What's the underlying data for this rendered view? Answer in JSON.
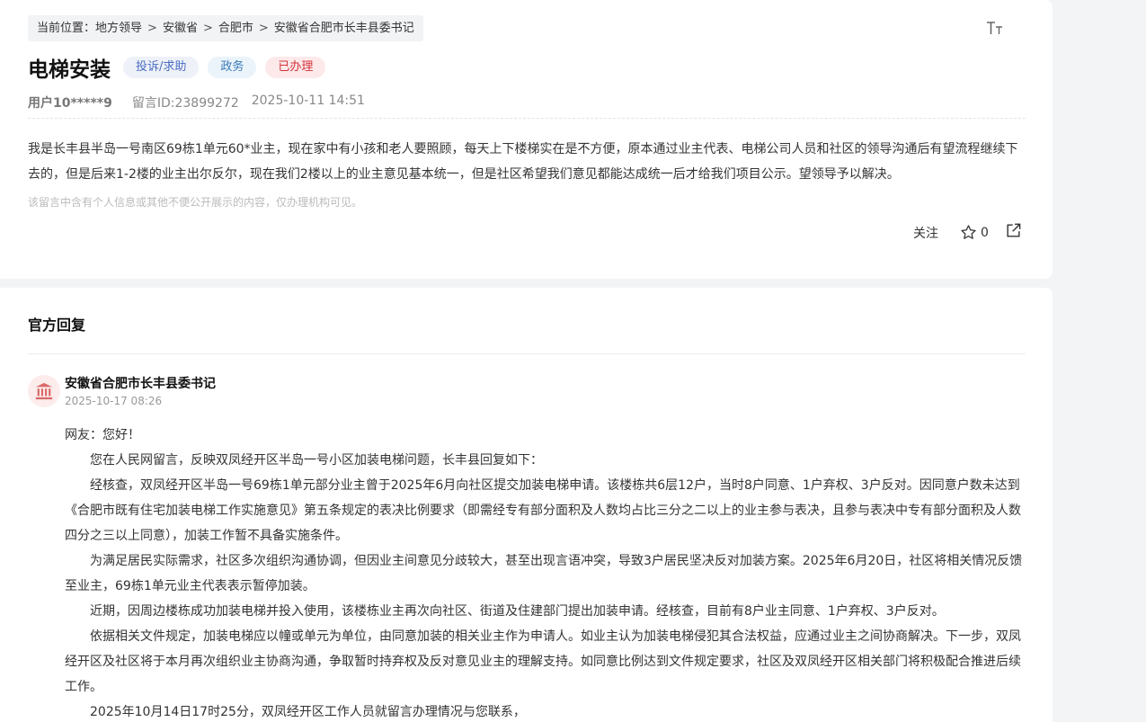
{
  "breadcrumb": {
    "prefix": "当前位置：",
    "items": [
      "地方领导",
      "安徽省",
      "合肥市",
      "安徽省合肥市长丰县委书记"
    ],
    "separator": ">"
  },
  "font_size_icon": "font-size-icon",
  "message": {
    "title": "电梯安装",
    "tags": [
      "投诉/求助",
      "政务",
      "已办理"
    ],
    "user": "用户10*****9",
    "message_id": "留言ID:23899272",
    "datetime": "2025-10-11 14:51",
    "content": "我是长丰县半岛一号南区69栋1单元60*业主，现在家中有小孩和老人要照顾，每天上下楼梯实在是不方便，原本通过业主代表、电梯公司人员和社区的领导沟通后有望流程继续下去的，但是后来1-2楼的业主出尔反尔，现在我们2楼以上的业主意见基本统一，但是社区希望我们意见都能达成统一后才给我们项目公示。望领导予以解决。",
    "privacy_hint": "该留言中含有个人信息或其他不便公开展示的内容，仅办理机构可见。"
  },
  "actions": {
    "follow_label": "关注",
    "star_count": "0"
  },
  "reply": {
    "section_title": "官方回复",
    "org_name": "安徽省合肥市长丰县委书记",
    "reply_time": "2025-10-17 08:26",
    "greeting": "网友：您好！",
    "paragraphs": [
      "您在人民网留言，反映双凤经开区半岛一号小区加装电梯问题，长丰县回复如下：",
      "经核查，双凤经开区半岛一号69栋1单元部分业主曾于2025年6月向社区提交加装电梯申请。该楼栋共6层12户，当时8户同意、1户弃权、3户反对。因同意户数未达到《合肥市既有住宅加装电梯工作实施意见》第五条规定的表决比例要求（即需经专有部分面积及人数均占比三分之二以上的业主参与表决，且参与表决中专有部分面积及人数四分之三以上同意），加装工作暂不具备实施条件。",
      "为满足居民实际需求，社区多次组织沟通协调，但因业主间意见分歧较大，甚至出现言语冲突，导致3户居民坚决反对加装方案。2025年6月20日，社区将相关情况反馈至业主，69栋1单元业主代表表示暂停加装。",
      "近期，因周边楼栋成功加装电梯并投入使用，该楼栋业主再次向社区、街道及住建部门提出加装申请。经核查，目前有8户业主同意、1户弃权、3户反对。",
      "依据相关文件规定，加装电梯应以幢或单元为单位，由同意加装的相关业主作为申请人。如业主认为加装电梯侵犯其合法权益，应通过业主之间协商解决。下一步，双凤经开区及社区将于本月再次组织业主协商沟通，争取暂时持弃权及反对意见业主的理解支持。如同意比例达到文件规定要求，社区及双凤经开区相关部门将积极配合推进后续工作。",
      "2025年10月14日17时25分，双凤经开区工作人员就留言办理情况与您联系，"
    ]
  },
  "colors": {
    "tag_red": "#d0333c",
    "tag_blue": "#4a6cc2",
    "avatar_bg": "#fdecec",
    "avatar_icon": "#d96a6a"
  }
}
